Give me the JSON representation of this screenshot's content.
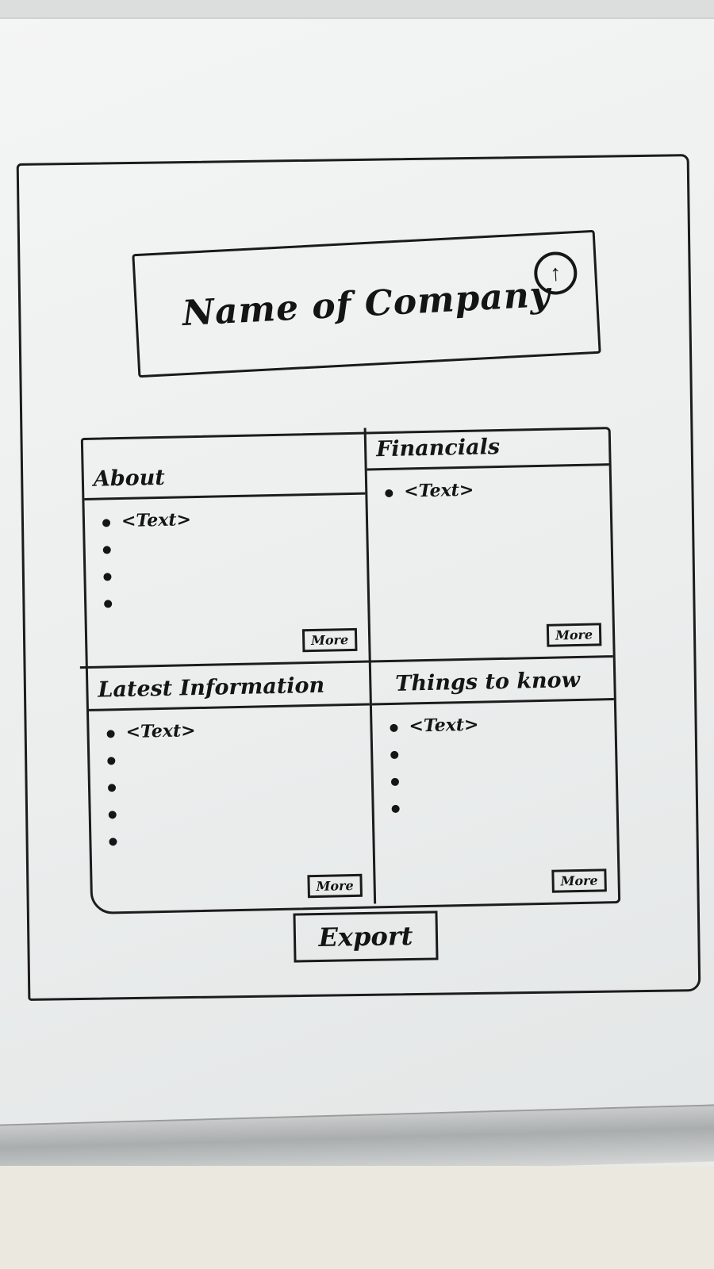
{
  "header": {
    "company_name": "Name of Company",
    "upload_icon": "arrow-up-circle-icon"
  },
  "panels": {
    "about": {
      "title": "About",
      "items": [
        "<Text>",
        "",
        "",
        ""
      ],
      "more_label": "More"
    },
    "financials": {
      "title": "Financials",
      "items": [
        "<Text>"
      ],
      "more_label": "More"
    },
    "latest_information": {
      "title": "Latest Information",
      "items": [
        "<Text>",
        "",
        "",
        "",
        ""
      ],
      "more_label": "More"
    },
    "things_to_know": {
      "title": "Things to know",
      "items": [
        "<Text>",
        "",
        "",
        ""
      ],
      "more_label": "More"
    }
  },
  "actions": {
    "export_label": "Export"
  }
}
